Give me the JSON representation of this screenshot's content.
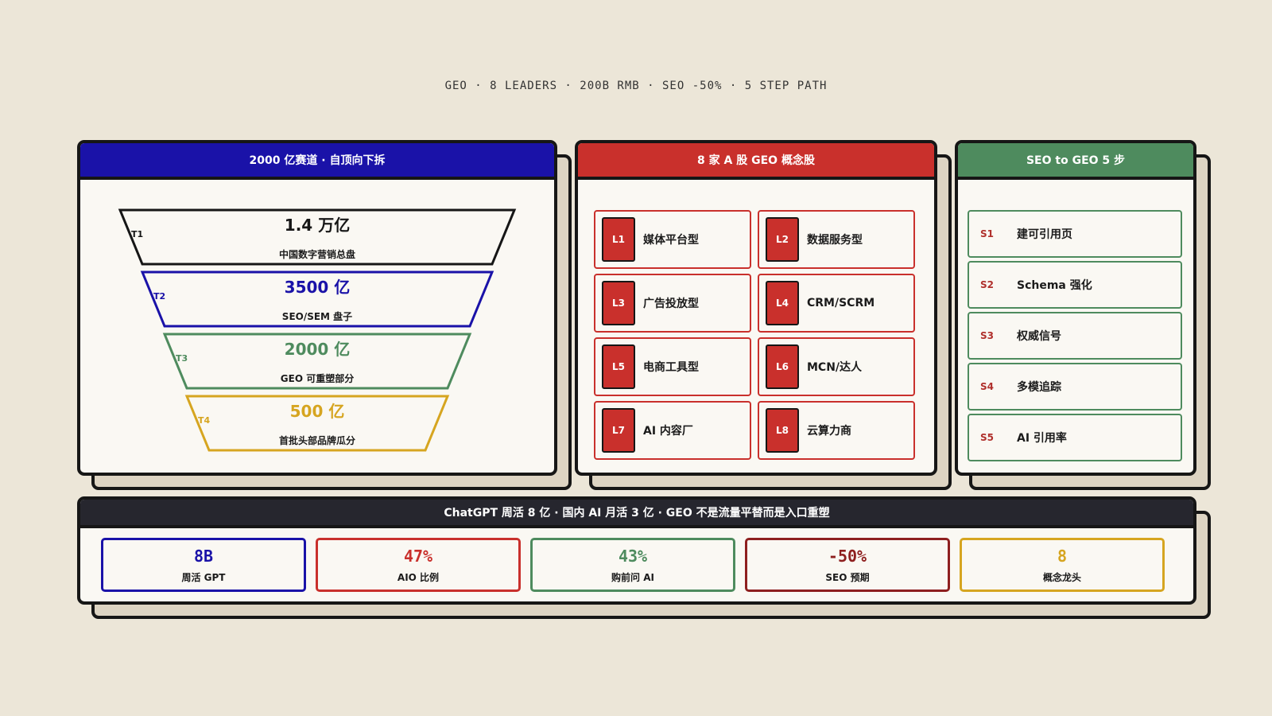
{
  "header_line": "GEO · 8 LEADERS · 200B RMB · SEO -50% · 5 STEP PATH",
  "colors": {
    "navy": "#1a12a8",
    "red": "#c9302c",
    "green": "#4e8b5e",
    "dark": "#26262e",
    "gold": "#d6a520",
    "maroon": "#8e1f1f",
    "bg": "#ece6d8"
  },
  "funnel_panel": {
    "title": "2000 亿赛道 · 自顶向下拆",
    "tiers": [
      {
        "tag": "T1",
        "value": "1.4 万亿",
        "label": "中国数字营销总盘",
        "color": "#161616"
      },
      {
        "tag": "T2",
        "value": "3500 亿",
        "label": "SEO/SEM 盘子",
        "color": "#1a12a8"
      },
      {
        "tag": "T3",
        "value": "2000 亿",
        "label": "GEO 可重塑部分",
        "color": "#4e8b5e"
      },
      {
        "tag": "T4",
        "value": "500 亿",
        "label": "首批头部品牌瓜分",
        "color": "#d6a520"
      }
    ]
  },
  "leaders_panel": {
    "title": "8 家 A 股 GEO 概念股",
    "items": [
      {
        "code": "L1",
        "label": "媒体平台型"
      },
      {
        "code": "L2",
        "label": "数据服务型"
      },
      {
        "code": "L3",
        "label": "广告投放型"
      },
      {
        "code": "L4",
        "label": "CRM/SCRM"
      },
      {
        "code": "L5",
        "label": "电商工具型"
      },
      {
        "code": "L6",
        "label": "MCN/达人"
      },
      {
        "code": "L7",
        "label": "AI 内容厂"
      },
      {
        "code": "L8",
        "label": "云算力商"
      }
    ]
  },
  "steps_panel": {
    "title": "SEO to GEO 5 步",
    "steps": [
      {
        "num": "S1",
        "label": "建可引用页"
      },
      {
        "num": "S2",
        "label": "Schema 强化"
      },
      {
        "num": "S3",
        "label": "权威信号"
      },
      {
        "num": "S4",
        "label": "多模追踪"
      },
      {
        "num": "S5",
        "label": "AI 引用率"
      }
    ]
  },
  "stats_panel": {
    "title": "ChatGPT 周活 8 亿 · 国内 AI 月活 3 亿 · GEO 不是流量平替而是入口重塑",
    "stats": [
      {
        "value": "8B",
        "label": "周活 GPT",
        "color": "#1a12a8"
      },
      {
        "value": "47%",
        "label": "AIO 比例",
        "color": "#c9302c"
      },
      {
        "value": "43%",
        "label": "购前问 AI",
        "color": "#4e8b5e"
      },
      {
        "value": "-50%",
        "label": "SEO 预期",
        "color": "#8e1f1f"
      },
      {
        "value": "8",
        "label": "概念龙头",
        "color": "#d6a520"
      }
    ]
  }
}
